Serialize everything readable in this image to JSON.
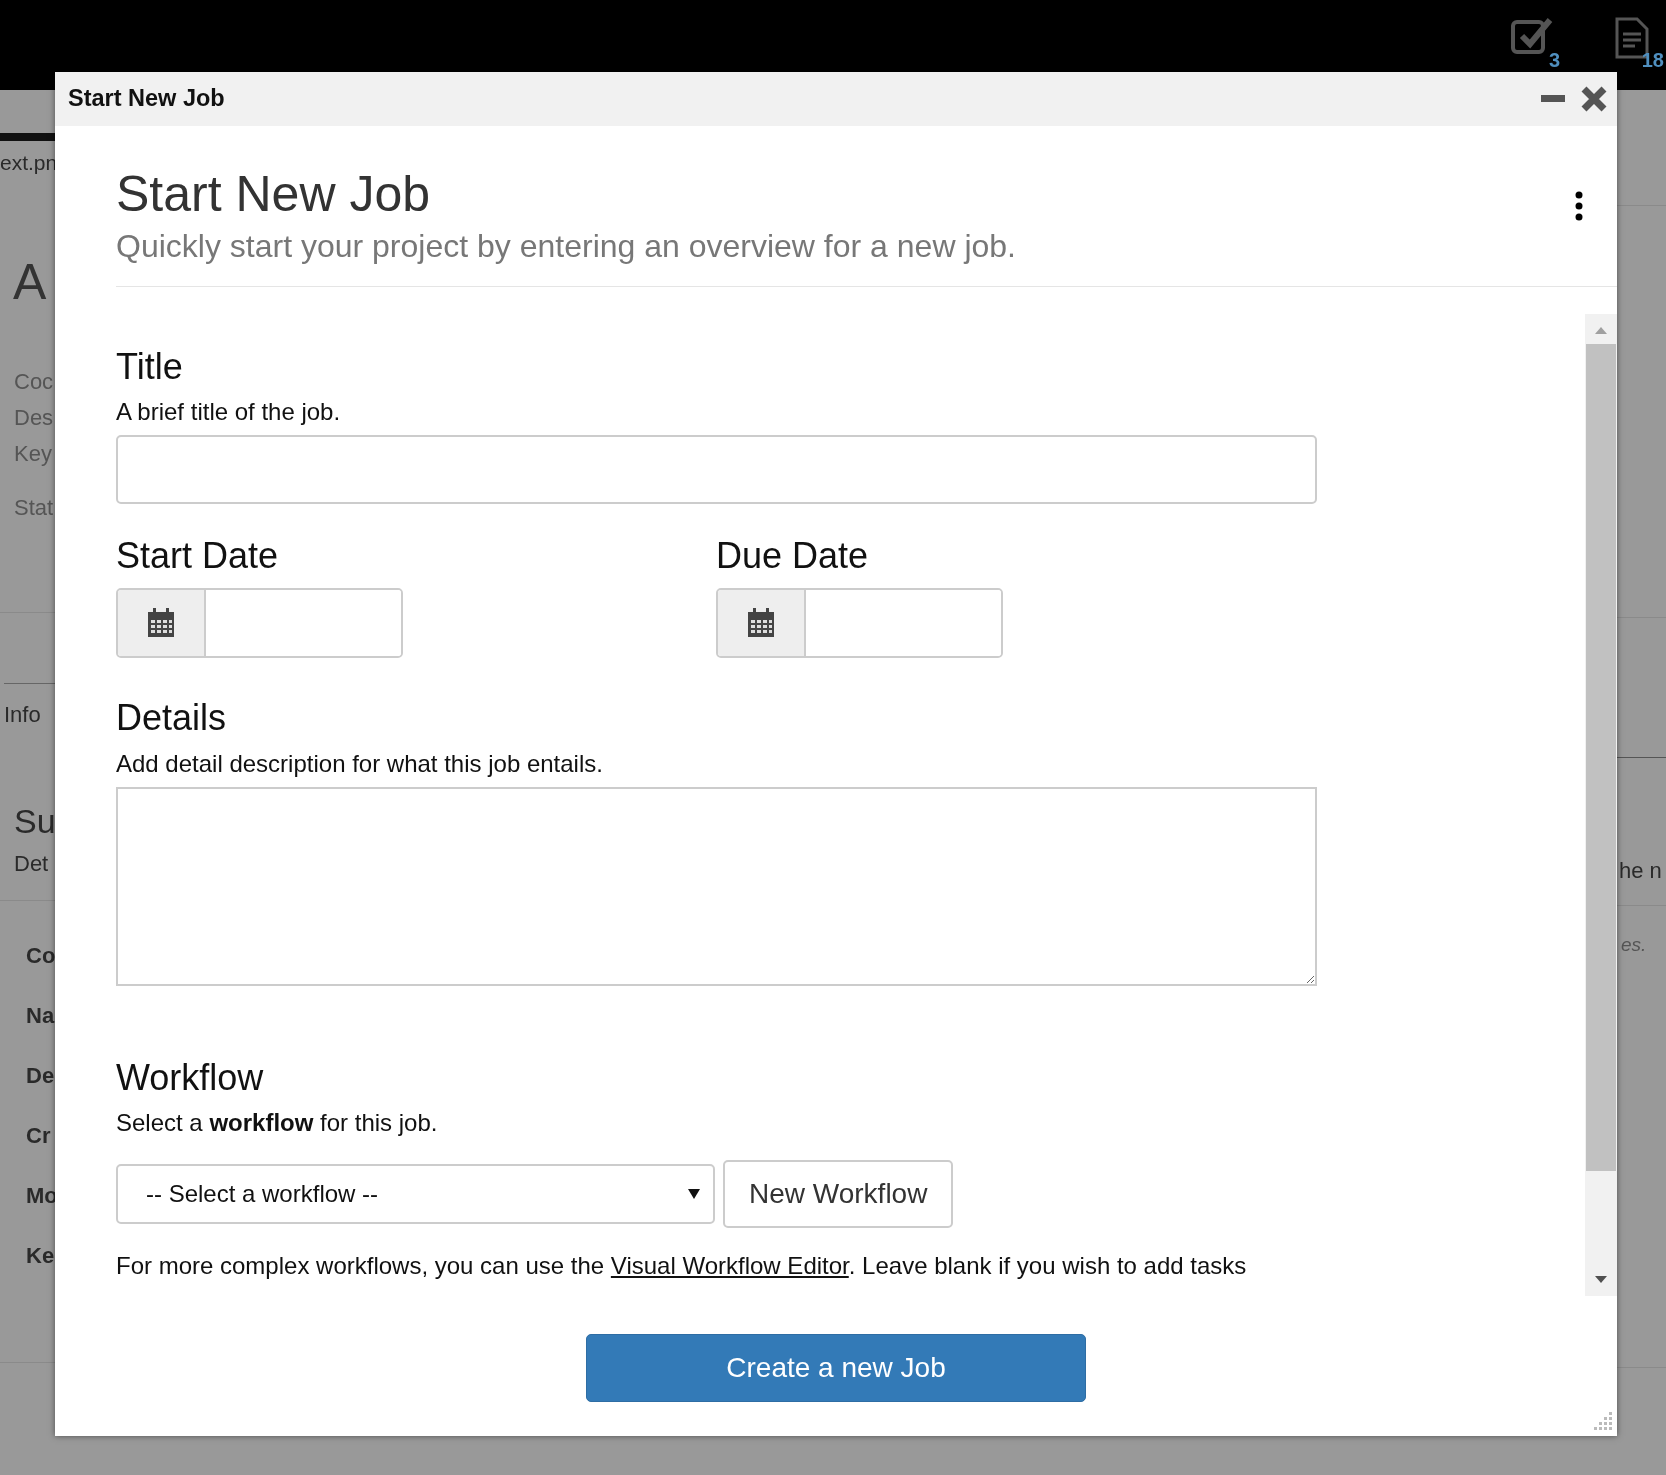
{
  "top_bar": {
    "icons": [
      {
        "kind": "tasks",
        "badge": "3"
      },
      {
        "kind": "documents",
        "badge": "18"
      }
    ]
  },
  "background": {
    "left": [
      {
        "kind": "file",
        "text": "ext.pn"
      },
      {
        "kind": "title",
        "text": "A"
      },
      {
        "kind": "meta",
        "text": "Coc"
      },
      {
        "kind": "meta",
        "text": "Des"
      },
      {
        "kind": "meta",
        "text": "Key"
      },
      {
        "kind": "meta-gap",
        "text": "Stat"
      },
      {
        "kind": "divider"
      },
      {
        "kind": "tab",
        "text": "Info"
      },
      {
        "kind": "section",
        "text": "Su"
      },
      {
        "kind": "sub",
        "text": "Det"
      },
      {
        "kind": "divider"
      },
      {
        "kind": "field",
        "text": "Co"
      },
      {
        "kind": "field",
        "text": "Na"
      },
      {
        "kind": "field",
        "text": "De"
      },
      {
        "kind": "field",
        "text": "Cr"
      },
      {
        "kind": "field",
        "text": "Mo"
      },
      {
        "kind": "field",
        "text": "Ke"
      },
      {
        "kind": "divider"
      }
    ],
    "right": [
      {
        "kind": "divider"
      },
      {
        "kind": "divider"
      },
      {
        "kind": "divider-dark"
      },
      {
        "kind": "sub",
        "text": "he n"
      },
      {
        "kind": "divider"
      },
      {
        "kind": "italic",
        "text": "es."
      },
      {
        "kind": "divider"
      }
    ]
  },
  "dialog": {
    "title": "Start New Job",
    "heading": "Start New Job",
    "subtitle": "Quickly start your project by entering an overview for a new job.",
    "title_field": {
      "label": "Title",
      "help": "A brief title of the job."
    },
    "dates": [
      {
        "label": "Start Date"
      },
      {
        "label": "Due Date"
      }
    ],
    "details": {
      "label": "Details",
      "help": "Add detail description for what this job entails."
    },
    "workflow": {
      "label": "Workflow",
      "help": "Select a **workflow** for this job.",
      "select_value": "-- Select a workflow --",
      "new_button": "New Workflow",
      "note_before": "For more complex workflows, you can use the ",
      "note_link": "Visual Workflow Editor",
      "note_after": ". Leave blank if you wish to add tasks"
    },
    "submit": "Create a new Job"
  }
}
